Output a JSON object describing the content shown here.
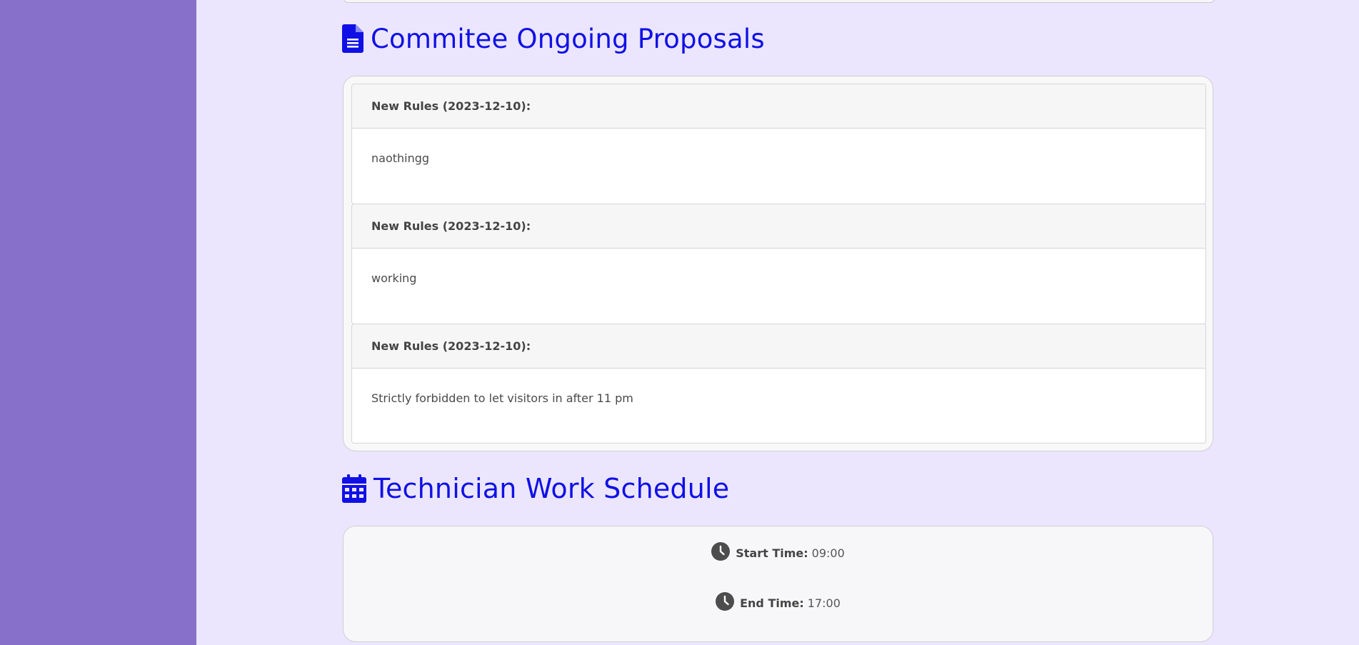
{
  "proposals": {
    "title": "Commitee Ongoing Proposals",
    "icon": "file-text-icon",
    "items": [
      {
        "heading": "New Rules (2023-12-10):",
        "body": "naothingg"
      },
      {
        "heading": "New Rules (2023-12-10):",
        "body": "working"
      },
      {
        "heading": "New Rules (2023-12-10):",
        "body": "Strictly forbidden to let visitors in after 11 pm"
      }
    ]
  },
  "schedule": {
    "title": "Technician Work Schedule",
    "icon": "calendar-icon",
    "start_label": "Start Time:",
    "start_value": "09:00",
    "end_label": "End Time:",
    "end_value": "17:00"
  },
  "colors": {
    "sidebar": "#8670c9",
    "background": "#ebe6fd",
    "heading": "#1010e6"
  }
}
